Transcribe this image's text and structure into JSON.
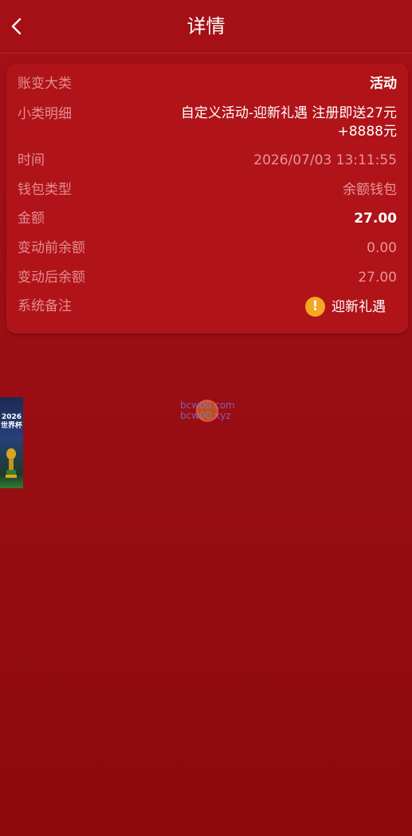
{
  "header": {
    "title": "详情"
  },
  "details": {
    "category_label": "账变大类",
    "category_value": "活动",
    "subcategory_label": "小类明细",
    "subcategory_value": "自定义活动-迎新礼遇 注册即送27元+8888元",
    "time_label": "时间",
    "time_value": "2026/07/03 13:11:55",
    "wallet_label": "钱包类型",
    "wallet_value": "余额钱包",
    "amount_label": "金额",
    "amount_value": "27.00",
    "before_label": "变动前余额",
    "before_value": "0.00",
    "after_label": "变动后余额",
    "after_value": "27.00",
    "note_label": "系统备注",
    "note_value": "迎新礼遇"
  },
  "banner": {
    "text": "2026世界杯",
    "icon": "world-cup-trophy-icon"
  },
  "watermark": {
    "line1": "bcw00.com",
    "line2": "bcw00.xyz"
  },
  "colors": {
    "background": "#9b0e14",
    "card": "#b01419",
    "label": "#e58d91",
    "warning": "#f5a623"
  }
}
